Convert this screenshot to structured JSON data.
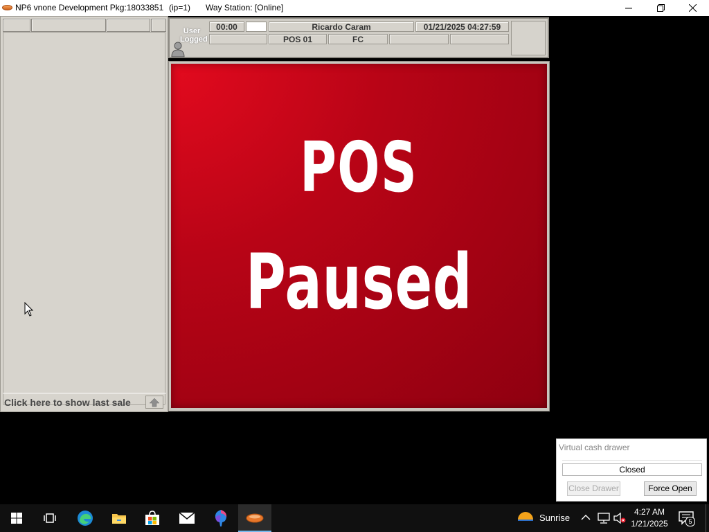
{
  "window": {
    "title": "NP6 vnone Development Pkg:18033851",
    "ip": "(ip=1)",
    "way_station": "Way Station: [Online]"
  },
  "left_panel": {
    "last_sale_label": "Click here to show last sale"
  },
  "header": {
    "user_logged": "User Logged",
    "timer": "00:00",
    "user_name": "Ricardo Caram",
    "datetime": "01/21/2025 04:27:59",
    "terminal": "POS 01",
    "code": "FC"
  },
  "pause_screen": {
    "line1": "POS",
    "line2": "Paused"
  },
  "cash_drawer": {
    "title": "Virtual cash drawer",
    "status": "Closed",
    "close_button": "Close Drawer",
    "force_open_button": "Force Open"
  },
  "taskbar": {
    "weather": "Sunrise",
    "time": "4:27 AM",
    "date": "1/21/2025",
    "notification_count": "5",
    "pinned": [
      "start-icon",
      "task-view-icon",
      "edge-icon",
      "file-explorer-icon",
      "store-icon",
      "mail-icon",
      "paint-icon",
      "np6-app-icon"
    ]
  },
  "colors": {
    "pause_red": "#b80416",
    "panel_gray": "#d7d4cd",
    "taskbar": "#101010"
  }
}
